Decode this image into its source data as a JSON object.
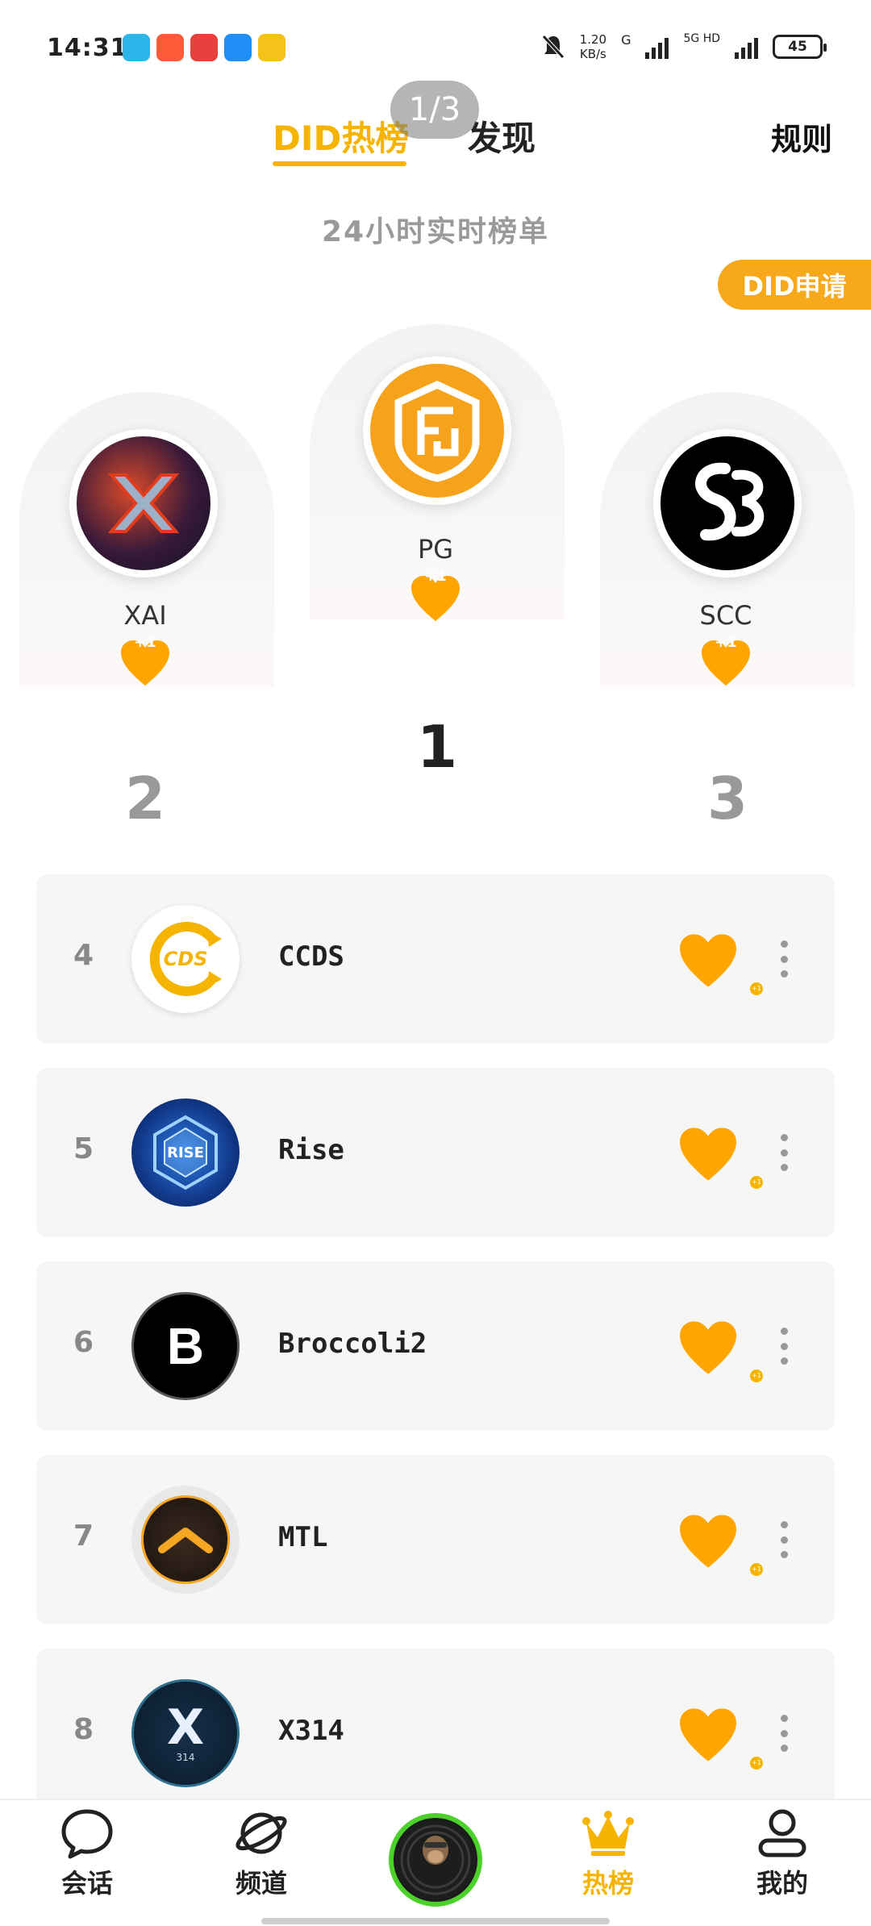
{
  "status_bar": {
    "time": "14:31",
    "net_speed_value": "1.20",
    "net_speed_unit": "KB/s",
    "network_1": "G",
    "network_2": "5G HD",
    "battery": "45"
  },
  "header": {
    "tab_hot": "DID热榜",
    "tab_discover": "发现",
    "rules": "规则",
    "page_indicator": "1/3"
  },
  "subtitle": "24小时实时榜单",
  "apply_button": "DID申请",
  "podium": [
    {
      "rank": "2",
      "name": "XAI",
      "plus": "+1"
    },
    {
      "rank": "1",
      "name": "PG",
      "plus": "+1"
    },
    {
      "rank": "3",
      "name": "SCC",
      "plus": "+1"
    }
  ],
  "list": [
    {
      "rank": "4",
      "name": "CCDS",
      "avatar_text": "CDS",
      "dot": "+1"
    },
    {
      "rank": "5",
      "name": "Rise",
      "avatar_text": "RISE",
      "dot": "+1"
    },
    {
      "rank": "6",
      "name": "Broccoli2",
      "avatar_text": "B",
      "dot": "+1"
    },
    {
      "rank": "7",
      "name": "MTL",
      "avatar_text": "",
      "dot": "+1"
    },
    {
      "rank": "8",
      "name": "X314",
      "avatar_text": "X",
      "avatar_sub": "314",
      "dot": "+1"
    }
  ],
  "bottom_nav": {
    "chat": "会话",
    "channel": "频道",
    "hot": "热榜",
    "mine": "我的"
  },
  "colors": {
    "accent": "#f6b400",
    "heart": "#ffa500",
    "apply": "#f7a81b"
  }
}
